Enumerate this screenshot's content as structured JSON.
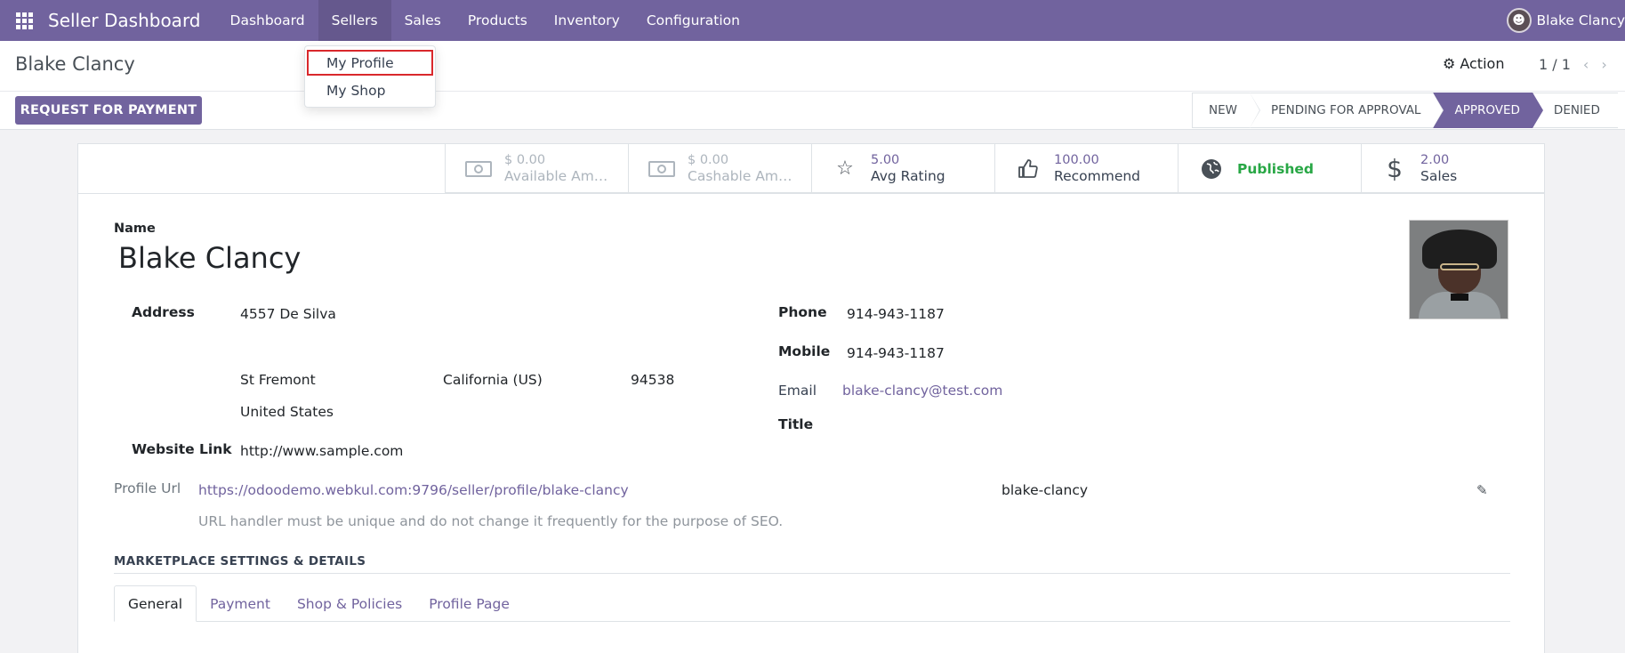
{
  "navbar": {
    "brand": "Seller Dashboard",
    "menu": [
      "Dashboard",
      "Sellers",
      "Sales",
      "Products",
      "Inventory",
      "Configuration"
    ],
    "user_name": "Blake Clancy"
  },
  "dropdown": {
    "items": [
      "My Profile",
      "My Shop"
    ]
  },
  "control": {
    "breadcrumb": "Blake Clancy",
    "action_label": "Action",
    "pager": "1 / 1",
    "request_button": "REQUEST FOR PAYMENT"
  },
  "statusbar": {
    "stages": [
      "NEW",
      "PENDING FOR APPROVAL",
      "APPROVED",
      "DENIED"
    ],
    "current": "APPROVED"
  },
  "stats": {
    "available": {
      "value": "$ 0.00",
      "label": "Available Am…"
    },
    "cashable": {
      "value": "$ 0.00",
      "label": "Cashable Am…"
    },
    "rating": {
      "value": "5.00",
      "label": "Avg Rating"
    },
    "recommend": {
      "value": "100.00",
      "label": "Recommend"
    },
    "published": {
      "label": "Published"
    },
    "sales": {
      "value": "2.00",
      "label": "Sales"
    }
  },
  "form": {
    "name_label": "Name",
    "name": "Blake Clancy",
    "address_label": "Address",
    "street": "4557 De Silva",
    "city": "St Fremont",
    "state": "California (US)",
    "zip": "94538",
    "country": "United States",
    "website_label": "Website Link",
    "website": "http://www.sample.com",
    "phone_label": "Phone",
    "phone": "914-943-1187",
    "mobile_label": "Mobile",
    "mobile": "914-943-1187",
    "email_label": "Email",
    "email": "blake-clancy@test.com",
    "title_label": "Title",
    "profile_url_label": "Profile Url",
    "profile_url": "https://odoodemo.webkul.com:9796/seller/profile/blake-clancy",
    "url_handle": "blake-clancy",
    "url_help": "URL handler must be unique and do not change it frequently for the purpose of SEO."
  },
  "section": {
    "title": "MARKETPLACE SETTINGS & DETAILS",
    "tabs": [
      "General",
      "Payment",
      "Shop & Policies",
      "Profile Page"
    ]
  }
}
